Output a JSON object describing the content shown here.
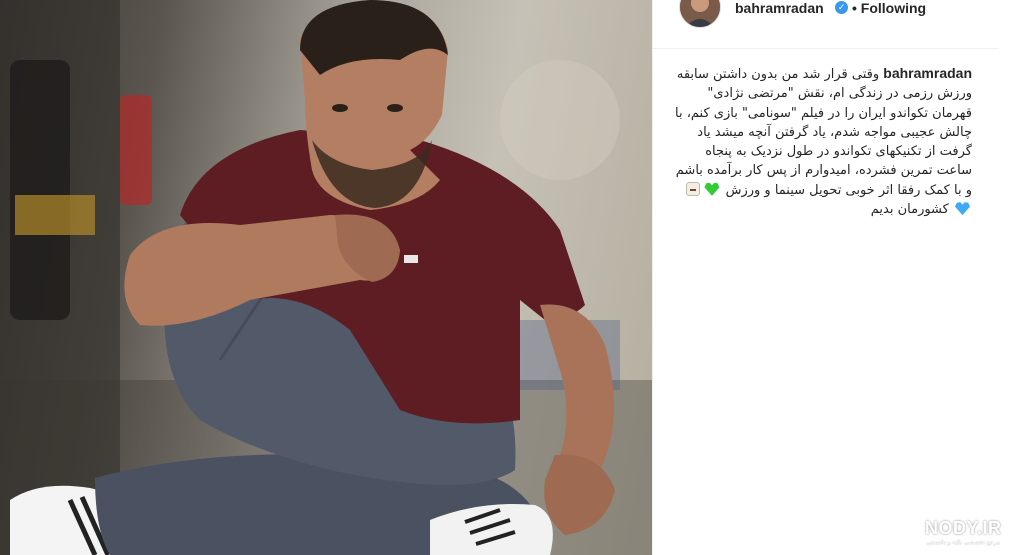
{
  "post": {
    "username": "bahramradan",
    "verified_icon": "verified-check-icon",
    "follow_status": "• Following",
    "caption_user": "bahramradan",
    "caption_text": "وقتی قرار شد من بدون داشتن سابقه ورزش رزمی در زندگی ام، نقش \"مرتضی نژادی\" قهرمان تکواندو ایران را در فیلم \"سونامی\" بازی کنم، با چالش عجیبی مواجه شدم، یاد گرفتن آنچه میشد یاد گرفت از تکنیکهای تکواندو در طول نزدیک به پنجاه ساعت تمرین فشرده، امیدوارم از پس کار برآمده باشم و با کمک رفقا اثر خوبی تحویل سینما و ورزش",
    "caption_tail": "کشورمان بدیم",
    "emojis": [
      "green-heart-icon",
      "martial-arts-uniform-icon",
      "blue-heart-icon"
    ]
  },
  "watermark": {
    "text": "NODY.IR",
    "subtext": "مرجع تخصصی نکته و دانستنی"
  },
  "colors": {
    "text": "#262626",
    "verified": "#3897f0",
    "shirt": "#5e1d22",
    "pants": "#4a5160"
  }
}
